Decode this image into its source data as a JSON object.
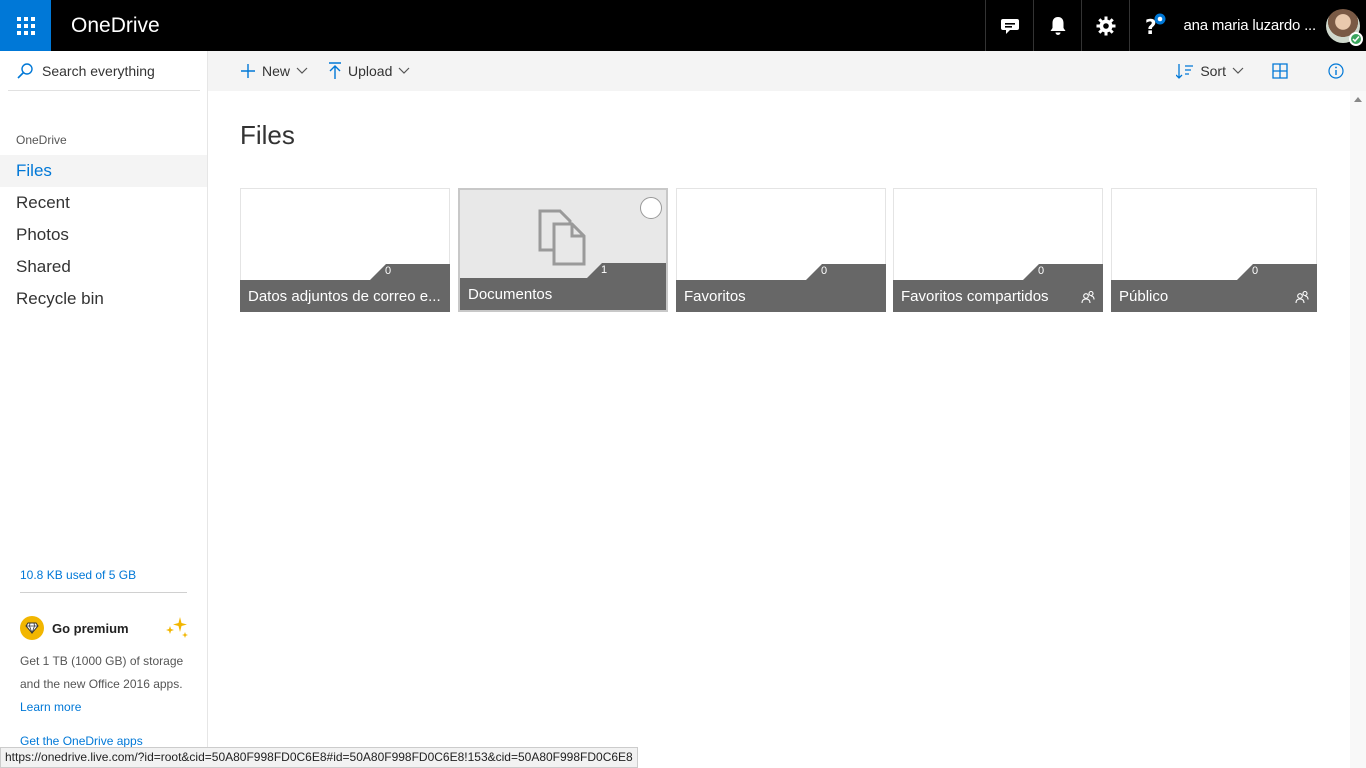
{
  "topbar": {
    "app_title": "OneDrive",
    "user_name": "ana maria luzardo ...",
    "icons": [
      "app-launcher-icon",
      "feedback-icon",
      "bell-icon",
      "gear-icon",
      "help-icon"
    ]
  },
  "commands": {
    "new_label": "New",
    "upload_label": "Upload",
    "sort_label": "Sort"
  },
  "sidebar": {
    "search_placeholder": "Search everything",
    "section_label": "OneDrive",
    "items": [
      {
        "label": "Files",
        "active": true
      },
      {
        "label": "Recent",
        "active": false
      },
      {
        "label": "Photos",
        "active": false
      },
      {
        "label": "Shared",
        "active": false
      },
      {
        "label": "Recycle bin",
        "active": false
      }
    ],
    "storage": "10.8 KB used of 5 GB",
    "premium": {
      "title": "Go premium",
      "description": "Get 1 TB (1000 GB) of storage and the new Office 2016 apps.",
      "link": "Learn more"
    },
    "get_apps": "Get the OneDrive apps"
  },
  "main": {
    "title": "Files",
    "folders": [
      {
        "name": "Datos adjuntos de correo e...",
        "count": "0",
        "shared": false,
        "selected": false
      },
      {
        "name": "Documentos",
        "count": "1",
        "shared": false,
        "selected": true
      },
      {
        "name": "Favoritos",
        "count": "0",
        "shared": false,
        "selected": false
      },
      {
        "name": "Favoritos compartidos",
        "count": "0",
        "shared": true,
        "selected": false
      },
      {
        "name": "Público",
        "count": "0",
        "shared": true,
        "selected": false
      }
    ]
  },
  "statusbar": {
    "url": "https://onedrive.live.com/?id=root&cid=50A80F998FD0C6E8#id=50A80F998FD0C6E8!153&cid=50A80F998FD0C6E8"
  },
  "colors": {
    "accent": "#0078d7",
    "topbar": "#000000",
    "tile_footer": "#676767"
  }
}
